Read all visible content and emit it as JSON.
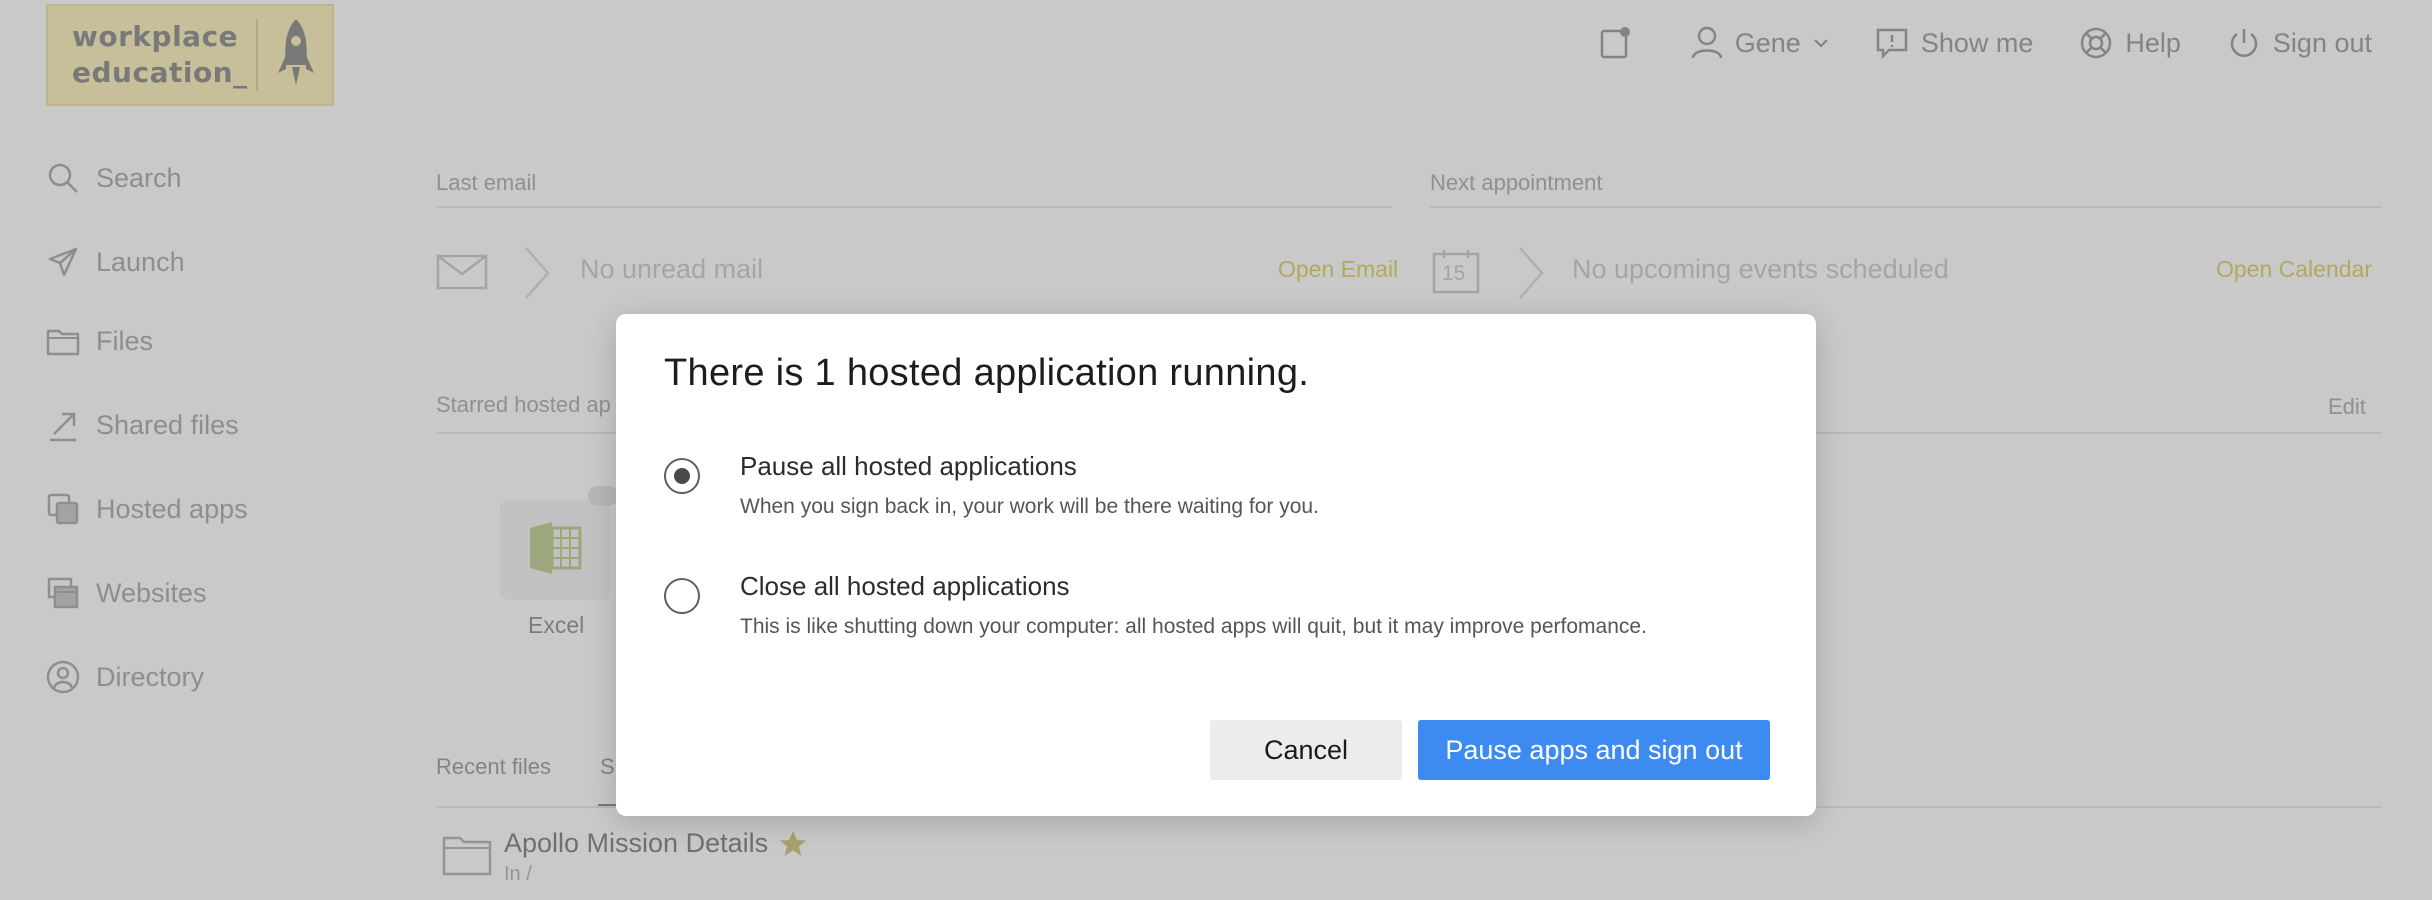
{
  "logo": {
    "line1": "workplace",
    "line2": "education_"
  },
  "topnav": {
    "notifications_icon": "notification-icon",
    "user_name": "Gene",
    "show_me": "Show me",
    "help": "Help",
    "sign_out": "Sign out"
  },
  "sidebar": {
    "items": [
      {
        "label": "Search",
        "icon": "search-icon"
      },
      {
        "label": "Launch",
        "icon": "rocket-icon"
      },
      {
        "label": "Files",
        "icon": "folder-icon"
      },
      {
        "label": "Shared files",
        "icon": "share-icon"
      },
      {
        "label": "Hosted apps",
        "icon": "hosted-apps-icon"
      },
      {
        "label": "Websites",
        "icon": "websites-icon"
      },
      {
        "label": "Directory",
        "icon": "directory-icon"
      }
    ]
  },
  "main": {
    "last_email_title": "Last email",
    "no_mail": "No unread mail",
    "open_email": "Open Email",
    "next_appointment_title": "Next appointment",
    "calendar_day": "15",
    "no_events": "No upcoming events scheduled",
    "open_calendar": "Open Calendar",
    "starred_title": "Starred hosted ap",
    "edit": "Edit",
    "app_excel": "Excel",
    "tab_recent": "Recent files",
    "tab_starred": "S",
    "file_name": "Apollo Mission Details",
    "file_location": "In /"
  },
  "dialog": {
    "title": "There is 1 hosted application running.",
    "option_pause": {
      "label": "Pause all hosted applications",
      "description": "When you sign back in, your work will be there waiting for you.",
      "selected": true
    },
    "option_close": {
      "label": "Close all hosted applications",
      "description": "This is like shutting down your computer: all hosted apps will quit, but it may improve perfomance.",
      "selected": false
    },
    "cancel_label": "Cancel",
    "primary_label": "Pause apps and sign out"
  },
  "colors": {
    "primary_button": "#3d8bf1",
    "logo_background": "#fbf3c4",
    "link_yellow": "#e0d77a"
  }
}
